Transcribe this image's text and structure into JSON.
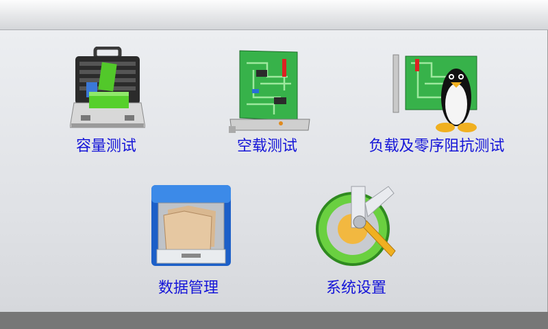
{
  "menu": {
    "items": [
      {
        "id": "capacity",
        "label": "容量测试",
        "icon": "toolbox-icon"
      },
      {
        "id": "no-load",
        "label": "空载测试",
        "icon": "circuit-board-icon"
      },
      {
        "id": "load-zero-seq",
        "label": "负载及零序阻抗测试",
        "icon": "linux-penguin-icon"
      },
      {
        "id": "data",
        "label": "数据管理",
        "icon": "file-cabinet-icon"
      },
      {
        "id": "settings",
        "label": "系统设置",
        "icon": "settings-gear-icon"
      }
    ]
  },
  "colors": {
    "label": "#1515d8",
    "background": "#dfe1e5",
    "bottom_bar": "#777777"
  }
}
